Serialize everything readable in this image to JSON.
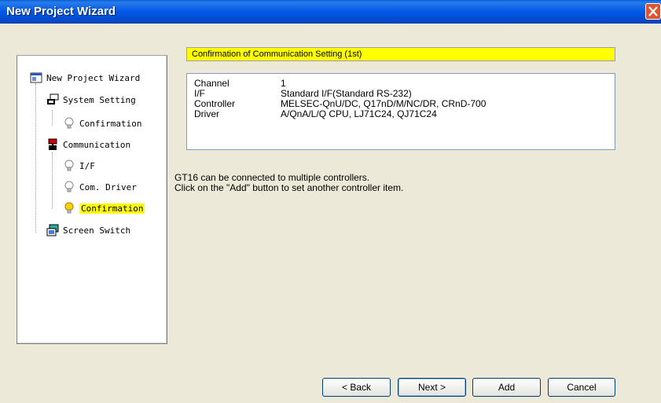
{
  "window": {
    "title": "New Project Wizard"
  },
  "tree": {
    "items": [
      {
        "label": "New Project Wizard",
        "icon": "wizard-icon"
      },
      {
        "label": "System Setting",
        "icon": "system-icon"
      },
      {
        "label": "Confirmation",
        "icon": "bulb-icon"
      },
      {
        "label": "Communication",
        "icon": "communication-icon"
      },
      {
        "label": "I/F",
        "icon": "bulb-icon"
      },
      {
        "label": "Com. Driver",
        "icon": "bulb-icon"
      },
      {
        "label": "Confirmation",
        "icon": "bulb-active-icon",
        "selected": true
      },
      {
        "label": "Screen Switch",
        "icon": "screen-switch-icon"
      }
    ]
  },
  "main": {
    "header": "Confirmation of Communication Setting (1st)",
    "info": [
      {
        "key": "Channel",
        "value": "1"
      },
      {
        "key": "I/F",
        "value": "Standard I/F(Standard RS-232)"
      },
      {
        "key": "Controller",
        "value": "MELSEC-QnU/DC, Q17nD/M/NC/DR, CRnD-700"
      },
      {
        "key": "Driver",
        "value": "A/QnA/L/Q CPU, LJ71C24, QJ71C24"
      }
    ],
    "message_line1": "GT16 can be connected to multiple controllers.",
    "message_line2": "Click on the \"Add\" button to set another controller item."
  },
  "buttons": {
    "back": "< Back",
    "next": "Next >",
    "add": "Add",
    "cancel": "Cancel"
  },
  "colors": {
    "title_bar": "#0058e6",
    "highlight": "#ffff00",
    "background": "#ece9d8"
  }
}
